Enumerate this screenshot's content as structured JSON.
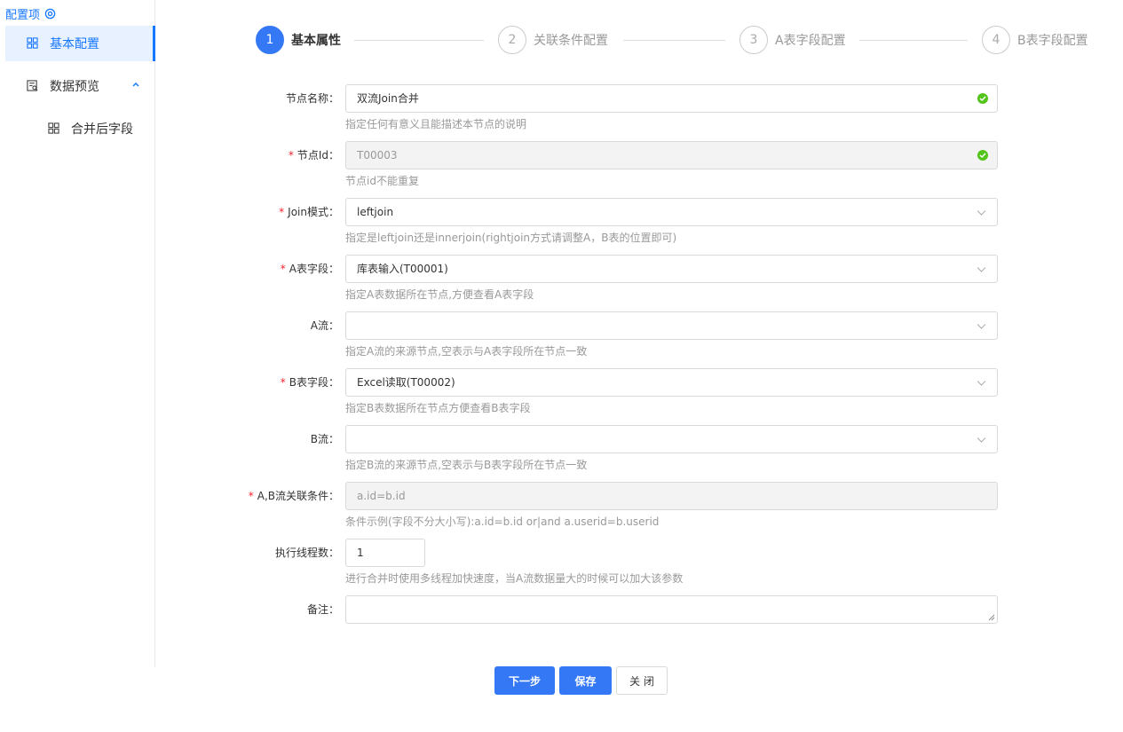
{
  "sidebar": {
    "title": "配置项",
    "items": [
      {
        "label": "基本配置",
        "icon": "grid-icon"
      },
      {
        "label": "数据预览",
        "icon": "preview-icon"
      },
      {
        "label": "合并后字段",
        "icon": "grid-icon"
      }
    ]
  },
  "steps": [
    {
      "num": "1",
      "label": "基本属性"
    },
    {
      "num": "2",
      "label": "关联条件配置"
    },
    {
      "num": "3",
      "label": "A表字段配置"
    },
    {
      "num": "4",
      "label": "B表字段配置"
    }
  ],
  "form": {
    "node_name": {
      "label": "节点名称：",
      "value": "双流Join合并",
      "hint": "指定任何有意义且能描述本节点的说明"
    },
    "node_id": {
      "label": "节点Id：",
      "value": "T00003",
      "hint": "节点id不能重复"
    },
    "join_mode": {
      "label": "Join模式：",
      "value": "leftjoin",
      "hint": "指定是leftjoin还是innerjoin(rightjoin方式请调整A，B表的位置即可)"
    },
    "a_table": {
      "label": "A表字段：",
      "value": "库表输入(T00001)",
      "hint": "指定A表数据所在节点,方便查看A表字段"
    },
    "a_stream": {
      "label": "A流：",
      "value": "",
      "hint": "指定A流的来源节点,空表示与A表字段所在节点一致"
    },
    "b_table": {
      "label": "B表字段：",
      "value": "Excel读取(T00002)",
      "hint": "指定B表数据所在节点方便查看B表字段"
    },
    "b_stream": {
      "label": "B流：",
      "value": "",
      "hint": "指定B流的来源节点,空表示与B表字段所在节点一致"
    },
    "condition": {
      "label": "A,B流关联条件：",
      "value": "a.id=b.id",
      "hint": "条件示例(字段不分大小写):a.id=b.id or|and a.userid=b.userid"
    },
    "threads": {
      "label": "执行线程数：",
      "value": "1",
      "hint": "进行合并时使用多线程加快速度，当A流数据量大的时候可以加大该参数"
    },
    "remark": {
      "label": "备注：",
      "value": ""
    }
  },
  "buttons": {
    "next": "下一步",
    "save": "保存",
    "close": "关 闭"
  },
  "colors": {
    "primary": "#3478f6",
    "required": "#f5222d",
    "success": "#52c41a"
  }
}
